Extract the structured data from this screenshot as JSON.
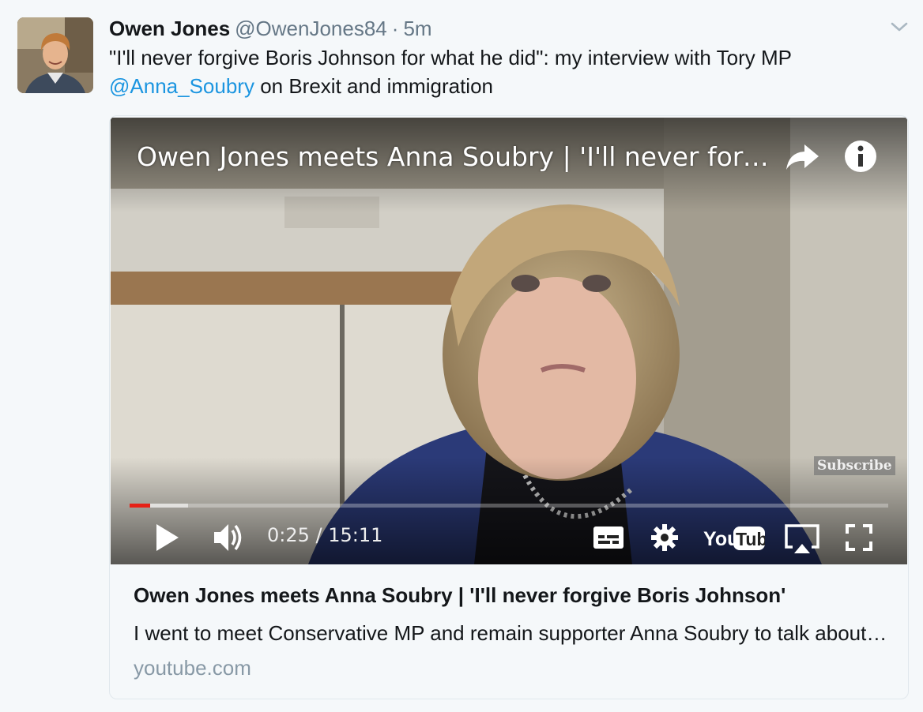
{
  "tweet": {
    "display_name": "Owen Jones",
    "handle": "@OwenJones84",
    "separator": "·",
    "time": "5m",
    "text_before_mention": "\"I'll never forgive Boris Johnson for what he did\": my interview with Tory MP ",
    "mention": "@Anna_Soubry",
    "text_after_mention": " on Brexit and immigration"
  },
  "video": {
    "title": "Owen Jones meets Anna Soubry | 'I'll never forgi...",
    "watermark": "Subscribe",
    "current_time": "0:25",
    "time_separator": " / ",
    "duration": "15:11",
    "progress_fraction": 0.0276,
    "buffered_fraction": 0.077,
    "progress_color": "#e62117",
    "logo_text_you": "You",
    "logo_text_tube": "Tube"
  },
  "card": {
    "title": "Owen Jones meets Anna Soubry | 'I'll never forgive Boris Johnson'",
    "description": "I went to meet Conservative MP and remain supporter Anna Soubry to talk about Brexit and immigration",
    "domain": "youtube.com"
  },
  "colors": {
    "link": "#1b95e0",
    "secondary_text": "#657786",
    "domain_text": "#8899a6",
    "background": "#f5f8fa"
  },
  "icons": {
    "caret": "chevron-down-icon",
    "share": "share-arrow-icon",
    "info": "info-icon",
    "play": "play-icon",
    "volume": "volume-icon",
    "captions": "captions-icon",
    "settings": "gear-icon",
    "airplay": "airplay-icon",
    "fullscreen": "fullscreen-icon"
  }
}
